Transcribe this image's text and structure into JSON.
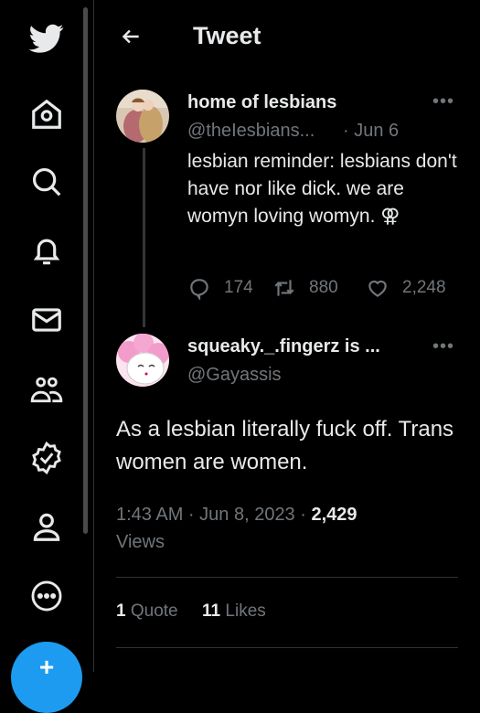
{
  "header": {
    "title": "Tweet"
  },
  "sidebar": {
    "icons": [
      "twitter-bird-icon",
      "home-icon",
      "search-icon",
      "bell-icon",
      "mail-icon",
      "communities-icon",
      "verified-icon",
      "profile-icon",
      "more-icon"
    ],
    "compose_glyph": "+"
  },
  "tweet1": {
    "name": "home of lesbians",
    "handle": "@theIesbians...",
    "date": "· Jun 6",
    "body": "lesbian reminder: lesbians don't have nor like dick. we are womyn loving womyn. ⚢",
    "more": "•••",
    "replies": "174",
    "retweets": "880",
    "likes": "2,248"
  },
  "tweet2": {
    "name": "squeaky._.fingerz is ...",
    "handle": "@Gayassis",
    "more": "•••",
    "body": "As a lesbian literally fuck off. Trans women are women.",
    "time": "1:43 AM · Jun 8, 2023 · ",
    "views_count": "2,429",
    "views_label": "Views",
    "quote_count": "1",
    "quote_label": " Quote",
    "likes_count": "11",
    "likes_label": " Likes"
  },
  "colors": {
    "accent": "#1d9bf0",
    "muted": "#71767b",
    "text": "#e7e9ea"
  }
}
